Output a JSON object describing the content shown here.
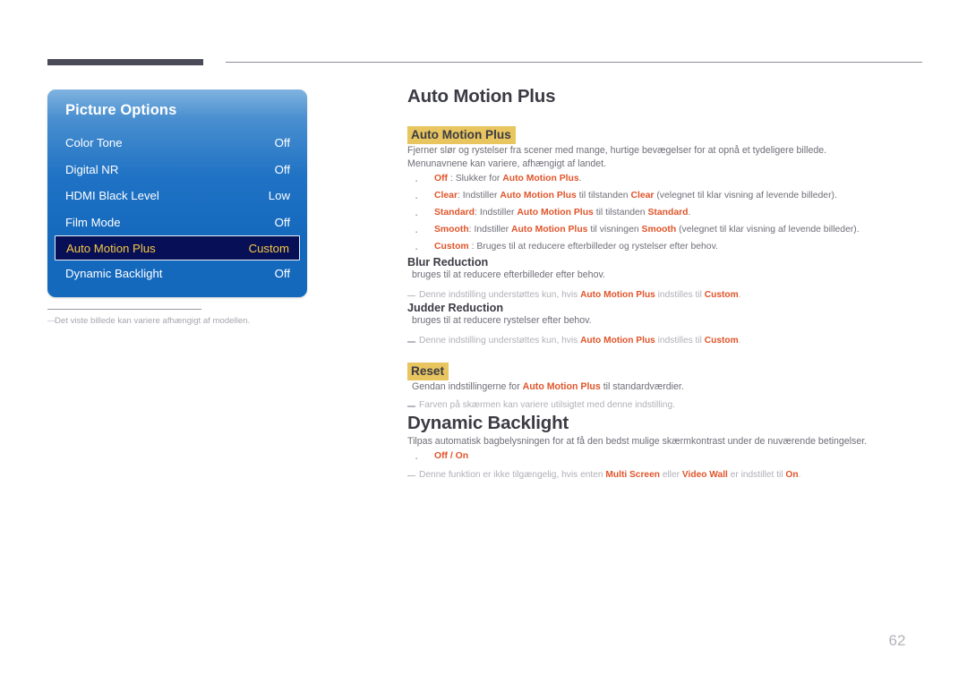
{
  "page": {
    "number": "62"
  },
  "osd": {
    "title": "Picture Options",
    "rows": [
      {
        "label": "Color Tone",
        "value": "Off",
        "selected": false
      },
      {
        "label": "Digital NR",
        "value": "Off",
        "selected": false
      },
      {
        "label": "HDMI Black Level",
        "value": "Low",
        "selected": false
      },
      {
        "label": "Film Mode",
        "value": "Off",
        "selected": false
      },
      {
        "label": "Auto Motion Plus",
        "value": "Custom",
        "selected": true
      },
      {
        "label": "Dynamic Backlight",
        "value": "Off",
        "selected": false
      }
    ],
    "caption": "Det viste billede kan variere afhængigt af modellen.",
    "caption_dash": "―"
  },
  "sections": {
    "auto_motion_plus": {
      "heading": "Auto Motion Plus",
      "highlight": "Auto Motion Plus",
      "intro_line1": "Fjerner slør og rystelser fra scener med mange, hurtige bevægelser for at opnå et tydeligere billede.",
      "intro_line2": "Menunavnene kan variere, afhængigt af landet.",
      "bullets": [
        {
          "term": "Off",
          "sep": " : ",
          "text_a": "Slukker for ",
          "em": "Auto Motion Plus",
          "text_b": "."
        },
        {
          "term": "Clear",
          "sep": ": ",
          "text_a": "Indstiller ",
          "em": "Auto Motion Plus",
          "text_b": " til tilstanden ",
          "em2": "Clear",
          "text_c": " (velegnet til klar visning af levende billeder)."
        },
        {
          "term": "Standard",
          "sep": ": ",
          "text_a": "Indstiller ",
          "em": "Auto Motion Plus",
          "text_b": " til tilstanden ",
          "em2": "Standard",
          "text_c": "."
        },
        {
          "term": "Smooth",
          "sep": ": ",
          "text_a": "Indstiller ",
          "em": "Auto Motion Plus",
          "text_b": " til visningen ",
          "em2": "Smooth",
          "text_c": " (velegnet til klar visning af levende billeder)."
        },
        {
          "term": "Custom",
          "sep": " : ",
          "text_a": "Bruges til at reducere efterbilleder og rystelser efter behov."
        }
      ]
    },
    "blur_reduction": {
      "heading": "Blur Reduction",
      "body": "bruges til at reducere efterbilleder efter behov.",
      "note_a": "Denne indstilling understøttes kun, hvis ",
      "note_em1": "Auto Motion Plus",
      "note_b": " indstilles til ",
      "note_em2": "Custom",
      "note_c": "."
    },
    "judder_reduction": {
      "heading": "Judder Reduction",
      "body": "bruges til at reducere rystelser efter behov.",
      "note_a": "Denne indstilling understøttes kun, hvis ",
      "note_em1": "Auto Motion Plus",
      "note_b": " indstilles til ",
      "note_em2": "Custom",
      "note_c": "."
    },
    "reset": {
      "highlight": "Reset",
      "body_a": "Gendan indstillingerne for ",
      "body_em": "Auto Motion Plus",
      "body_b": " til standardværdier.",
      "note": "Farven på skærmen kan variere utilsigtet med denne indstilling."
    },
    "dynamic_backlight": {
      "heading": "Dynamic Backlight",
      "body": "Tilpas automatisk bagbelysningen for at få den bedst mulige skærmkontrast under de nuværende betingelser.",
      "bullet": "Off / On",
      "note_a": "Denne funktion er ikke tilgængelig, hvis enten ",
      "note_em1": "Multi Screen",
      "note_b": " eller ",
      "note_em2": "Video Wall",
      "note_c": " er indstillet til ",
      "note_em3": "On",
      "note_d": "."
    }
  },
  "colors": {
    "accent_orange": "#e0552b",
    "highlight_gold": "#e8c55f",
    "osd_blue": "#1569bd",
    "osd_selected_bg": "#071057",
    "osd_selected_text": "#f5c842",
    "header_bar": "#4a4a58"
  }
}
